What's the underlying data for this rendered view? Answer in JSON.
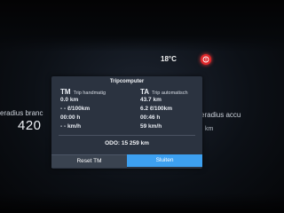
{
  "status": {
    "temperature": "18°C"
  },
  "background": {
    "left_label": "eradius branc",
    "left_value": "420",
    "right_label": "eradius accu",
    "right_unit": "km"
  },
  "tripcomputer": {
    "title": "Tripcomputer",
    "tm": {
      "code": "TM",
      "label": "Trip handmatig",
      "distance": "0.0 km",
      "consumption": "- - ℓ/100km",
      "time": "00:00 h",
      "speed": "- - km/h"
    },
    "ta": {
      "code": "TA",
      "label": "Trip automatisch",
      "distance": "43.7 km",
      "consumption": "6.2 ℓ/100km",
      "time": "00:46 h",
      "speed": "59 km/h"
    },
    "odo": "ODO:  15 259 km",
    "buttons": {
      "reset": "Reset TM",
      "close": "Sluiten"
    }
  },
  "colors": {
    "accent": "#3da0f0",
    "warning": "#e0272a"
  }
}
